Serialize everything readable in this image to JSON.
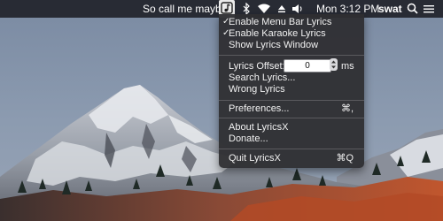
{
  "menubar": {
    "song": "So call me maybe",
    "clock": "Mon 3:12 PM",
    "user": "swat",
    "icons": [
      "lyricsx-icon",
      "bluetooth-icon",
      "wifi-icon",
      "eject-icon",
      "volume-icon",
      "search-icon",
      "list-icon"
    ]
  },
  "menu": {
    "items": [
      {
        "label": "Enable Menu Bar Lyrics",
        "checked": true
      },
      {
        "label": "Enable Karaoke Lyrics",
        "checked": true
      },
      {
        "label": "Show Lyrics Window",
        "checked": false
      }
    ],
    "offset": {
      "label": "Lyrics Offset:",
      "value": "0",
      "unit": "ms"
    },
    "search": "Search Lyrics...",
    "wrong": "Wrong Lyrics",
    "preferences": {
      "label": "Preferences...",
      "shortcut": "⌘,"
    },
    "about": "About LyricsX",
    "donate": "Donate...",
    "quit": {
      "label": "Quit LyricsX",
      "shortcut": "⌘Q"
    },
    "check_glyph": "✓"
  }
}
